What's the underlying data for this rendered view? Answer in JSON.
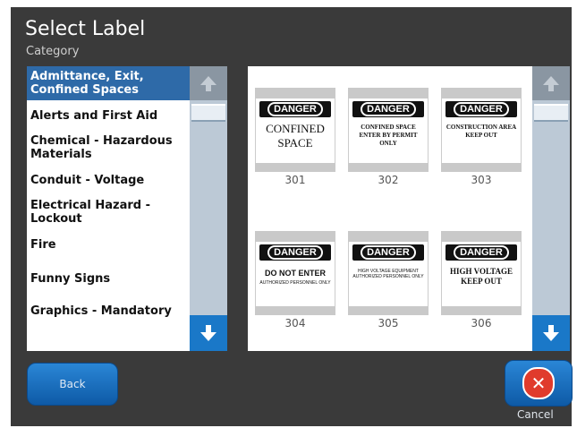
{
  "header": {
    "title": "Select Label",
    "subtitle": "Category"
  },
  "categories": [
    {
      "label": "Admittance, Exit, Confined Spaces",
      "selected": true
    },
    {
      "label": "Alerts and First Aid"
    },
    {
      "label": "Chemical - Hazardous Materials"
    },
    {
      "label": "Conduit - Voltage"
    },
    {
      "label": "Electrical Hazard - Lockout"
    },
    {
      "label": "Fire"
    },
    {
      "label": "Funny Signs"
    },
    {
      "label": "Graphics - Mandatory"
    }
  ],
  "labels": [
    {
      "number": "301",
      "header": "DANGER",
      "text": "CONFINED SPACE"
    },
    {
      "number": "302",
      "header": "DANGER",
      "text": "CONFINED SPACE ENTER BY PERMIT ONLY"
    },
    {
      "number": "303",
      "header": "DANGER",
      "text": "CONSTRUCTION AREA KEEP OUT"
    },
    {
      "number": "304",
      "header": "DANGER",
      "text": "DO NOT ENTER",
      "subtext": "AUTHORIZED PERSONNEL ONLY"
    },
    {
      "number": "305",
      "header": "DANGER",
      "text": "HIGH VOLTAGE EQUIPMENT AUTHORIZED PERSONNEL ONLY"
    },
    {
      "number": "306",
      "header": "DANGER",
      "text": "HIGH VOLTAGE KEEP OUT"
    }
  ],
  "buttons": {
    "back": "Back",
    "cancel": "Cancel"
  },
  "colors": {
    "background": "#3a3a3a",
    "accent": "#1a78c8",
    "selected": "#2e6aa8",
    "cancel_icon": "#e03b2c"
  }
}
